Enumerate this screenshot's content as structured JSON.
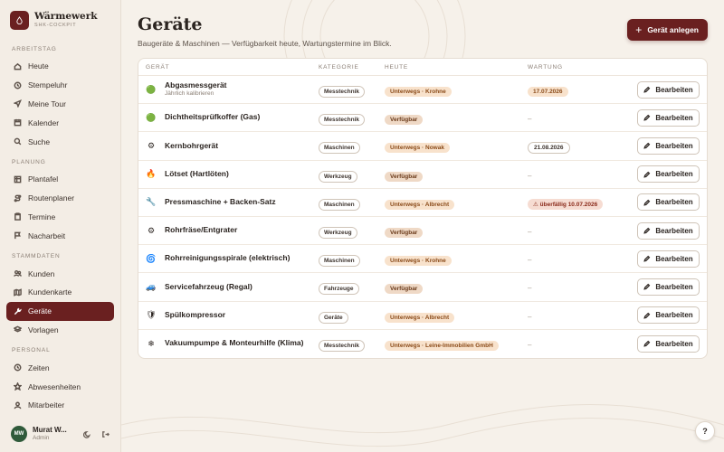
{
  "brand": {
    "name": "Wärmewerk",
    "subtitle": "SHK-COCKPIT",
    "logo_icon": "flame-drop-icon"
  },
  "sidebar": {
    "sections": [
      {
        "label": "ARBEITSTAG",
        "items": [
          {
            "label": "Heute",
            "icon": "home-icon"
          },
          {
            "label": "Stempeluhr",
            "icon": "clock-icon"
          },
          {
            "label": "Meine Tour",
            "icon": "navigation-icon"
          },
          {
            "label": "Kalender",
            "icon": "calendar-icon"
          },
          {
            "label": "Suche",
            "icon": "search-icon"
          }
        ]
      },
      {
        "label": "PLANUNG",
        "items": [
          {
            "label": "Plantafel",
            "icon": "board-icon"
          },
          {
            "label": "Routenplaner",
            "icon": "route-icon"
          },
          {
            "label": "Termine",
            "icon": "clipboard-icon"
          },
          {
            "label": "Nacharbeit",
            "icon": "flag-icon"
          }
        ]
      },
      {
        "label": "STAMMDATEN",
        "items": [
          {
            "label": "Kunden",
            "icon": "users-icon"
          },
          {
            "label": "Kundenkarte",
            "icon": "map-icon"
          },
          {
            "label": "Geräte",
            "icon": "wrench-icon",
            "active": true
          },
          {
            "label": "Vorlagen",
            "icon": "layers-icon"
          }
        ]
      },
      {
        "label": "PERSONAL",
        "items": [
          {
            "label": "Zeiten",
            "icon": "clock-icon"
          },
          {
            "label": "Abwesenheiten",
            "icon": "star-icon"
          },
          {
            "label": "Mitarbeiter",
            "icon": "user-icon"
          }
        ]
      }
    ]
  },
  "user": {
    "initials": "MW",
    "name": "Murat W...",
    "role": "Admin"
  },
  "page": {
    "title": "Geräte",
    "subtitle": "Baugeräte & Maschinen — Verfügbarkeit heute, Wartungstermine im Blick.",
    "add_button": "Gerät anlegen"
  },
  "table": {
    "columns": {
      "name": "GERÄT",
      "category": "KATEGORIE",
      "today": "HEUTE",
      "maintenance": "WARTUNG"
    },
    "edit_label": "Bearbeiten",
    "rows": [
      {
        "name": "Abgasmessgerät",
        "sub": "Jährlich kalibrieren",
        "icon": "🟢",
        "category": "Messtechnik",
        "today": "Unterwegs · Krohne",
        "status": "out",
        "maintenance": "17.07.2026",
        "maint_kind": "future"
      },
      {
        "name": "Dichtheitsprüfkoffer (Gas)",
        "sub": "",
        "icon": "🟢",
        "category": "Messtechnik",
        "today": "Verfügbar",
        "status": "avail",
        "maintenance": "–",
        "maint_kind": "none"
      },
      {
        "name": "Kernbohrgerät",
        "sub": "",
        "icon": "⚙",
        "category": "Maschinen",
        "today": "Unterwegs · Nowak",
        "status": "out",
        "maintenance": "21.08.2026",
        "maint_kind": "plain"
      },
      {
        "name": "Lötset (Hartlöten)",
        "sub": "",
        "icon": "🔥",
        "category": "Werkzeug",
        "today": "Verfügbar",
        "status": "avail",
        "maintenance": "–",
        "maint_kind": "none"
      },
      {
        "name": "Pressmaschine + Backen-Satz",
        "sub": "",
        "icon": "🔧",
        "category": "Maschinen",
        "today": "Unterwegs · Albrecht",
        "status": "out",
        "maintenance": "⚠ überfällig 10.07.2026",
        "maint_kind": "overdue"
      },
      {
        "name": "Rohrfräse/Entgrater",
        "sub": "",
        "icon": "⚙",
        "category": "Werkzeug",
        "today": "Verfügbar",
        "status": "avail",
        "maintenance": "–",
        "maint_kind": "none"
      },
      {
        "name": "Rohrreinigungsspirale (elektrisch)",
        "sub": "",
        "icon": "🌀",
        "category": "Maschinen",
        "today": "Unterwegs · Krohne",
        "status": "out",
        "maintenance": "–",
        "maint_kind": "none"
      },
      {
        "name": "Servicefahrzeug (Regal)",
        "sub": "",
        "icon": "🚙",
        "category": "Fahrzeuge",
        "today": "Verfügbar",
        "status": "avail",
        "maintenance": "–",
        "maint_kind": "none"
      },
      {
        "name": "Spülkompressor",
        "sub": "",
        "icon": "🛡",
        "category": "Geräte",
        "today": "Unterwegs · Albrecht",
        "status": "out",
        "maintenance": "–",
        "maint_kind": "none"
      },
      {
        "name": "Vakuumpumpe & Monteurhilfe (Klima)",
        "sub": "",
        "icon": "❄",
        "category": "Messtechnik",
        "today": "Unterwegs · Leine-Immobilien GmbH",
        "status": "out",
        "maintenance": "–",
        "maint_kind": "none"
      }
    ]
  },
  "help": {
    "label": "?"
  },
  "colors": {
    "accent": "#6a2020",
    "background": "#f6f1ea"
  }
}
